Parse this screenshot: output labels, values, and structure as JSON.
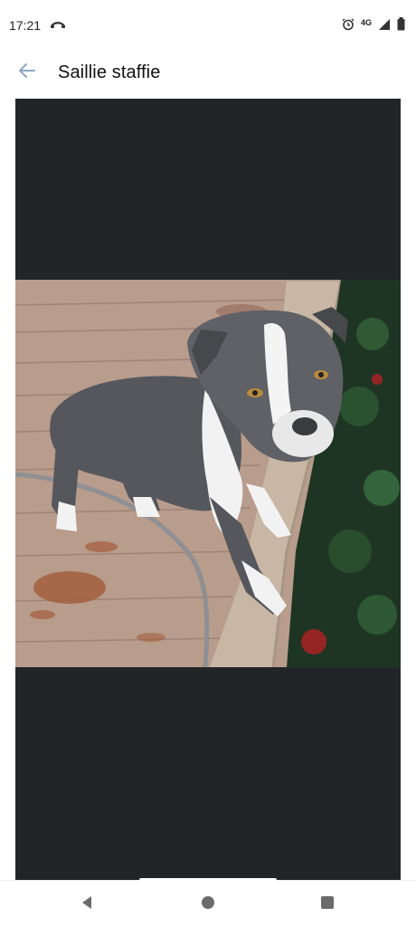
{
  "status_bar": {
    "time": "17:21",
    "network": "4G",
    "icons": [
      "missed-call-icon",
      "alarm-icon",
      "signal-icon",
      "battery-icon"
    ]
  },
  "app_bar": {
    "back_icon": "arrow-back-icon",
    "title": "Saillie staffie"
  },
  "viewer": {
    "background": "#222528",
    "image": "photo of a blue-grey and white staffordshire terrier standing on a wooden deck"
  },
  "nav_bar": {
    "buttons": [
      "back-triangle-icon",
      "home-circle-icon",
      "recents-square-icon"
    ],
    "icon_color": "#6b6b6b"
  }
}
